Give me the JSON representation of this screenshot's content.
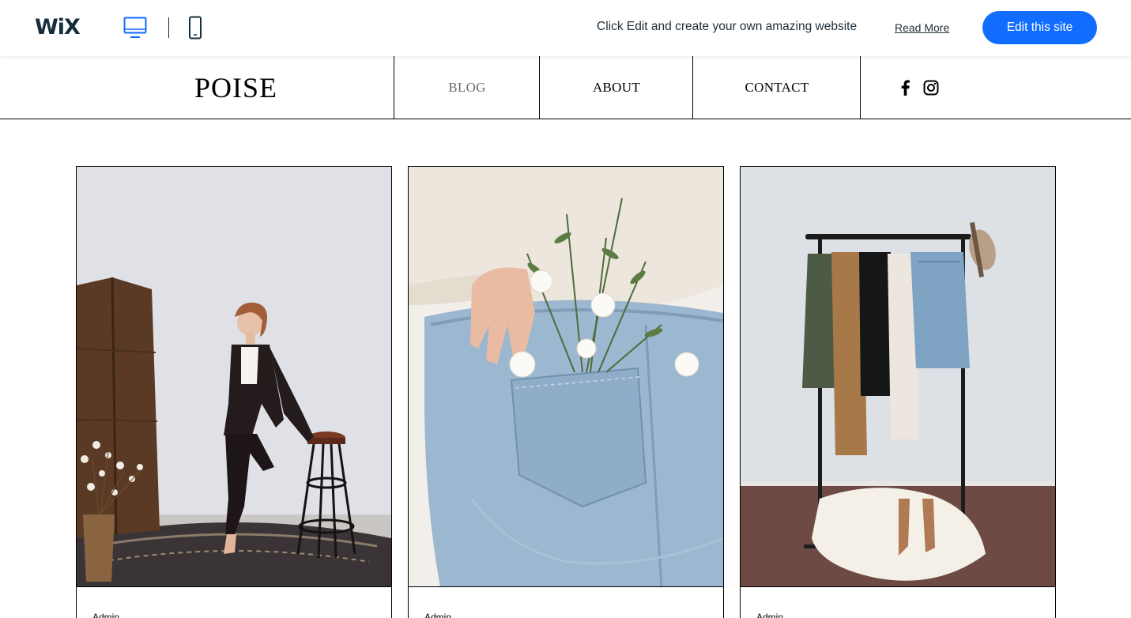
{
  "wix_bar": {
    "logo": "WiX",
    "message": "Click Edit and create your own amazing website",
    "read_more": "Read More",
    "edit_button": "Edit this site",
    "accent_color": "#116dff"
  },
  "site": {
    "logo": "POISE",
    "nav": {
      "blog": "BLOG",
      "about": "ABOUT",
      "contact": "CONTACT"
    },
    "social": [
      "facebook-icon",
      "instagram-icon"
    ]
  },
  "posts": [
    {
      "author": "Admin",
      "image": "woman in dark suit leaning on bar stool"
    },
    {
      "author": "Admin",
      "image": "jeans back pocket with white flowers"
    },
    {
      "author": "Admin",
      "image": "clothing rack with jackets, hat and heels"
    }
  ]
}
